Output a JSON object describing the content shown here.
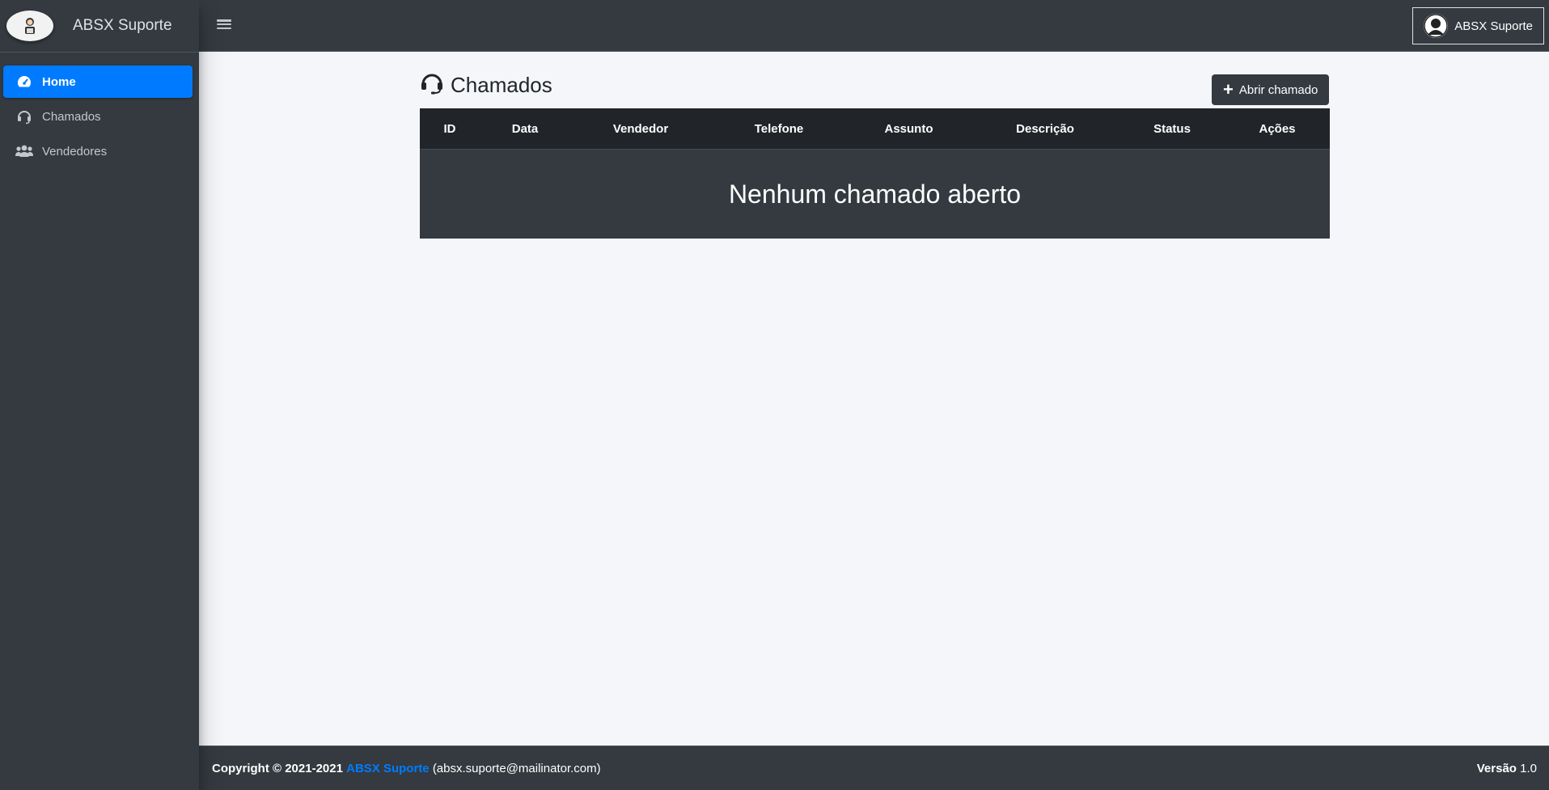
{
  "brand": {
    "name": "ABSX Suporte"
  },
  "sidebar": {
    "items": [
      {
        "label": "Home",
        "icon": "tachometer-icon",
        "active": true
      },
      {
        "label": "Chamados",
        "icon": "headset-icon",
        "active": false
      },
      {
        "label": "Vendedores",
        "icon": "users-icon",
        "active": false
      }
    ]
  },
  "topbar": {
    "user_label": "ABSX Suporte"
  },
  "page": {
    "title": "Chamados",
    "open_button": "Abrir chamado",
    "table": {
      "columns": [
        "ID",
        "Data",
        "Vendedor",
        "Telefone",
        "Assunto",
        "Descrição",
        "Status",
        "Ações"
      ],
      "empty_message": "Nenhum chamado aberto"
    }
  },
  "footer": {
    "copyright": "Copyright © 2021-2021",
    "brand_link": "ABSX Suporte",
    "email": "(absx.suporte@mailinator.com)",
    "version_label": "Versão",
    "version_value": "1.0"
  },
  "colors": {
    "accent": "#007bff",
    "dark": "#343a40",
    "background": "#f4f6f9"
  }
}
